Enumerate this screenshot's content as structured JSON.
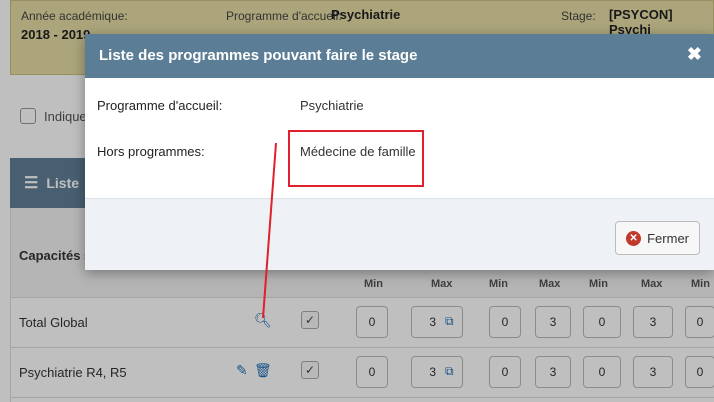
{
  "info_bar": {
    "academic_year_label": "Année académique:",
    "academic_year_value": "2018 - 2019",
    "program_label": "Programme d'accueil:",
    "program_value": "Psychiatrie",
    "stage_label": "Stage:",
    "stage_value": "[PSYCON] Psychi"
  },
  "indicator": {
    "label": "Indique"
  },
  "list_header": {
    "title": "Liste"
  },
  "table": {
    "capacities_label": "Capacités s",
    "sub_headers": [
      "Min",
      "Max",
      "Min",
      "Max",
      "Min",
      "Max",
      "Min"
    ],
    "rows": [
      {
        "label": "Total Global",
        "checked": "✓",
        "values": [
          "0",
          "3",
          "0",
          "3",
          "0",
          "3",
          "0"
        ]
      },
      {
        "label": "Psychiatrie R4, R5",
        "checked": "✓",
        "values": [
          "0",
          "3",
          "0",
          "3",
          "0",
          "3",
          "0"
        ]
      }
    ]
  },
  "modal": {
    "title": "Liste des programmes pouvant faire le stage",
    "close_symbol": "✖",
    "fields": [
      {
        "label": "Programme d'accueil:",
        "value": "Psychiatrie"
      },
      {
        "label": "Hors programmes:",
        "value": "Médecine de famille"
      }
    ],
    "close_button_label": "Fermer"
  },
  "colors": {
    "modal_header": "#5b7d95",
    "info_bar": "#e6dca4",
    "annotation_red": "#e0202c",
    "link_blue": "#1f6fb6"
  }
}
